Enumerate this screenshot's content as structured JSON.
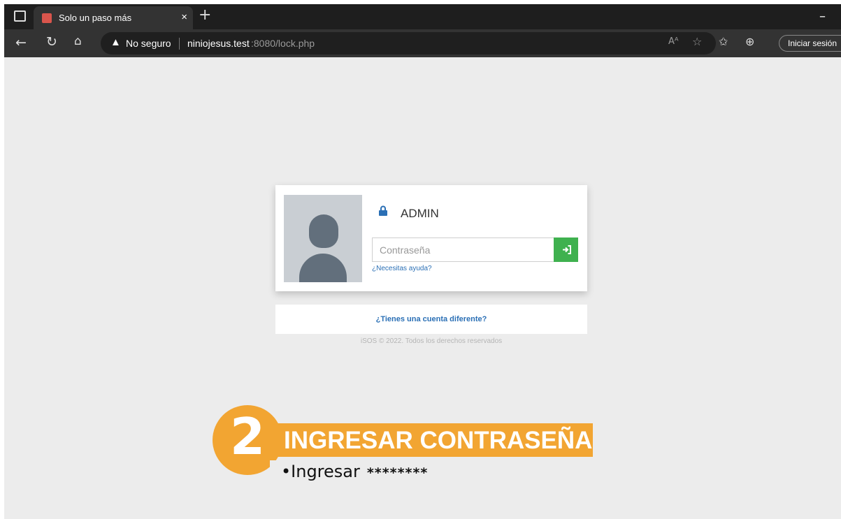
{
  "browser": {
    "tab_title": "Solo un paso más",
    "tab_close": "×",
    "new_tab": "+",
    "minimize": "–",
    "security_label": "No seguro",
    "url_host": "niniojesus.test",
    "url_rest": ":8080/lock.php",
    "signin_label": "Iniciar sesión"
  },
  "lock_screen": {
    "username": "ADMIN",
    "password_placeholder": "Contraseña",
    "help_link": "¿Necesitas ayuda?",
    "different_account": "¿Tienes una cuenta diferente?",
    "copyright": "iSOS © 2022. Todos los derechos reservados"
  },
  "overlay": {
    "step_number": "2",
    "step_title": "INGRESAR CONTRASEÑA",
    "instruction": "Ingresar",
    "masked_password": "********"
  },
  "colors": {
    "accent": "#f2a532",
    "login_button": "#3fb14f",
    "link": "#2a6fb5"
  },
  "icons": [
    "sidebar-toggle-icon",
    "favicon-icon",
    "back-icon",
    "reload-icon",
    "home-icon",
    "warning-icon",
    "read-aloud-icon",
    "add-favorite-icon",
    "favorites-icon",
    "collections-icon",
    "lock-icon",
    "login-arrow-icon"
  ]
}
